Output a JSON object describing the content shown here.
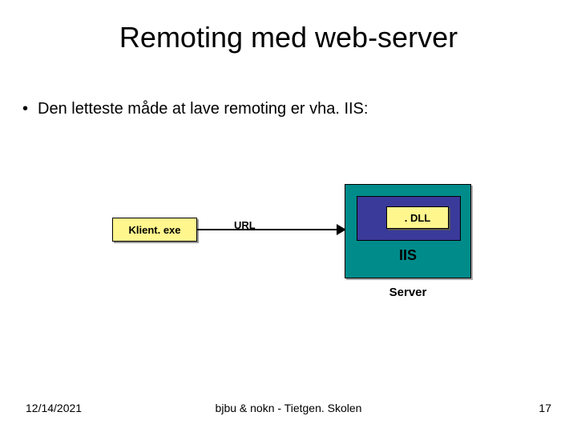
{
  "title": "Remoting med web-server",
  "bullet": "Den letteste måde at lave remoting er vha. IIS:",
  "diagram": {
    "client": "Klient. exe",
    "url": "URL",
    "dll": ". DLL",
    "iis": "IIS",
    "server": "Server"
  },
  "footer": {
    "date": "12/14/2021",
    "center": "bjbu & nokn - Tietgen. Skolen",
    "page": "17"
  }
}
